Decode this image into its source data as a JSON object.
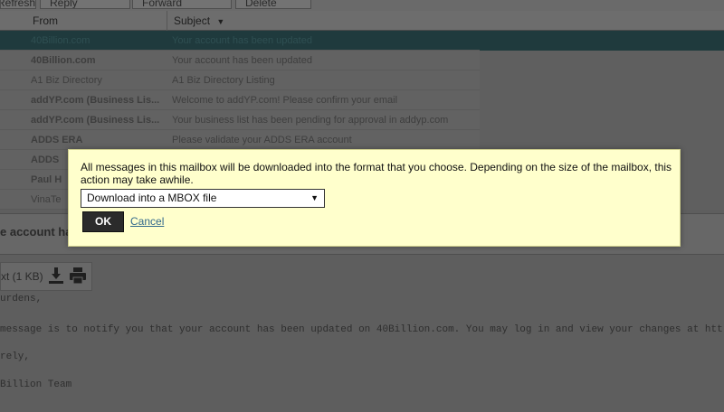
{
  "toolbar": {
    "refresh_label": "Refresh",
    "reply_label": "Reply",
    "forward_label": "Forward",
    "delete_label": "Delete"
  },
  "columns": {
    "from": "From",
    "subject": "Subject"
  },
  "messages": [
    {
      "from": "40Billion.com",
      "subject": "Your account has been updated"
    },
    {
      "from": "40Billion.com",
      "subject": "Your account has been updated"
    },
    {
      "from": "A1 Biz Directory",
      "subject": "A1 Biz Directory Listing"
    },
    {
      "from": "addYP.com (Business Lis...",
      "subject": "Welcome to addYP.com! Please confirm your email"
    },
    {
      "from": "addYP.com (Business Lis...",
      "subject": "Your business list has been pending for approval in addyp.com"
    },
    {
      "from": "ADDS ERA",
      "subject": "Please validate your ADDS ERA account"
    },
    {
      "from": "ADDS",
      "subject": ""
    },
    {
      "from": "Paul H",
      "subject": ""
    },
    {
      "from": "VinaTe",
      "subject": ""
    }
  ],
  "preview": {
    "subject_fragment": "e account ha",
    "attachment_label": "xt (1 KB)",
    "body_lines": [
      "urdens,",
      "message is to notify you that your account has been updated on 40Billion.com. You may log in and view your changes at htt",
      "rely,",
      "Billion Team"
    ]
  },
  "dialog": {
    "message": "All messages in this mailbox will be downloaded into the format that you choose. Depending on the size of the mailbox, this action may take awhile.",
    "select_value": "Download into a MBOX file",
    "ok_label": "OK",
    "cancel_label": "Cancel"
  },
  "colors": {
    "dialog_bg": "#ffffcc",
    "selected_row": "#1f3a3d",
    "link": "#336a8c"
  }
}
